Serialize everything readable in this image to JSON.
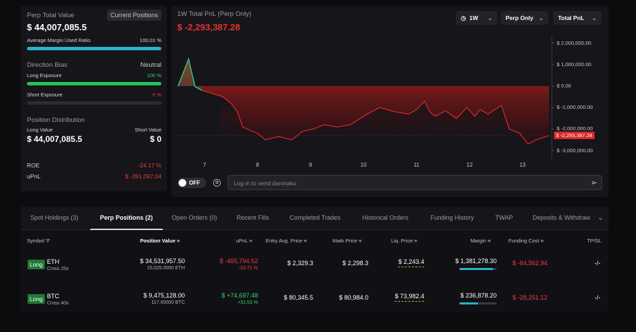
{
  "summary": {
    "perp_total_label": "Perp Total Value",
    "current_positions": "Current Positions",
    "perp_total_value": "$ 44,007,085.5",
    "avg_margin_label": "Average Margin Used Ratio",
    "avg_margin_value": "100.01 %",
    "avg_margin_level": 1.0,
    "direction_label": "Direction Bias",
    "direction_value": "Neutral",
    "long_exp_label": "Long Exposure",
    "long_exp_value": "100 %",
    "long_exp_level": 1.0,
    "short_exp_label": "Short Exposure",
    "short_exp_value": "0 %",
    "short_exp_level": 0,
    "dist_label": "Position Distribution",
    "long_value_label": "Long Value",
    "short_value_label": "Short Value",
    "long_value": "$ 44,007,085.5",
    "short_value": "$ 0",
    "roe_label": "ROE",
    "roe_value": "-24.17 %",
    "upnl_label": "uPnL",
    "upnl_value": "$ -391,097.04"
  },
  "chart": {
    "title": "1W Total PnL (Perp Only)",
    "value": "$ -2,293,387.28",
    "period": "1W",
    "filter": "Perp Only",
    "metric": "Total PnL",
    "toggle": "OFF",
    "danmaku_placeholder": "Log in to send danmaku",
    "current_label": "$ -2,293,387.28"
  },
  "chart_data": {
    "type": "area",
    "y_ticks": [
      "$ 2,000,000.00",
      "$ 1,000,000.00",
      "$ 0.00",
      "$ -1,000,000.00",
      "$ -2,000,000.00",
      "$ -3,000,000.00"
    ],
    "x_ticks": [
      "7",
      "8",
      "9",
      "10",
      "11",
      "12",
      "13"
    ],
    "ylim": [
      -3300000,
      2400000
    ],
    "x": [
      6.5,
      6.7,
      6.82,
      6.95,
      7.15,
      7.35,
      7.5,
      7.62,
      7.72,
      7.9,
      8.0,
      8.15,
      8.4,
      8.65,
      8.85,
      9.05,
      9.25,
      9.5,
      9.75,
      10.0,
      10.3,
      10.6,
      10.85,
      11.0,
      11.15,
      11.25,
      11.35,
      11.55,
      11.75,
      11.95,
      12.1,
      12.2,
      12.35,
      12.6,
      12.75,
      12.95,
      13.1,
      13.25,
      13.5
    ],
    "y": [
      -10000,
      1250000,
      -20000,
      -200000,
      -350000,
      -500000,
      -800000,
      -1200000,
      -1900000,
      -2100000,
      -2200000,
      -2500000,
      -2350000,
      -2500000,
      -2100000,
      -2000000,
      -1800000,
      -1900000,
      -1800000,
      -1400000,
      -1000000,
      -1200000,
      -1300000,
      -1100000,
      -700000,
      -1200000,
      -1400000,
      -1150000,
      -1500000,
      -1000000,
      -1400000,
      -1100000,
      -1300000,
      -900000,
      -2000000,
      -2200000,
      -2700000,
      -2500000,
      -2300000
    ]
  },
  "tabs": [
    "Spot Holdings (3)",
    "Perp Positions (2)",
    "Open Orders (0)",
    "Recent Fills",
    "Completed Trades",
    "Historical Orders",
    "Funding History",
    "TWAP",
    "Deposits & Withdraw"
  ],
  "columns": [
    "Symbol",
    "Position Value",
    "uPnL",
    "Entry Avg. Price",
    "Mark Price",
    "Liq. Price",
    "Margin",
    "Funding Cost",
    "TP/SL"
  ],
  "rows": [
    {
      "side": "Long",
      "coin": "ETH",
      "lev": "Cross 25x",
      "value": "$ 34,531,957.50",
      "size": "15,025.0000 ETH",
      "upnl": "$ -465,794.52",
      "upnl_pct": "-33.72 %",
      "entry": "$ 2,329.3",
      "mark": "$ 2,298.3",
      "liq": "$ 2,243.4",
      "margin": "$ 1,381,278.30",
      "margin_level": 0.9,
      "funding": "$ -84,562.94",
      "tpsl": "-/-",
      "pos": "neg"
    },
    {
      "side": "Long",
      "coin": "BTC",
      "lev": "Cross 40x",
      "value": "$ 9,475,128.00",
      "size": "117.00000 BTC",
      "upnl": "$ +74,697.48",
      "upnl_pct": "+31.53 %",
      "entry": "$ 80,345.5",
      "mark": "$ 80,984.0",
      "liq": "$ 73,982.4",
      "margin": "$ 236,878.20",
      "margin_level": 0.5,
      "funding": "$ -28,251.12",
      "tpsl": "-/-",
      "pos": "pos"
    }
  ]
}
